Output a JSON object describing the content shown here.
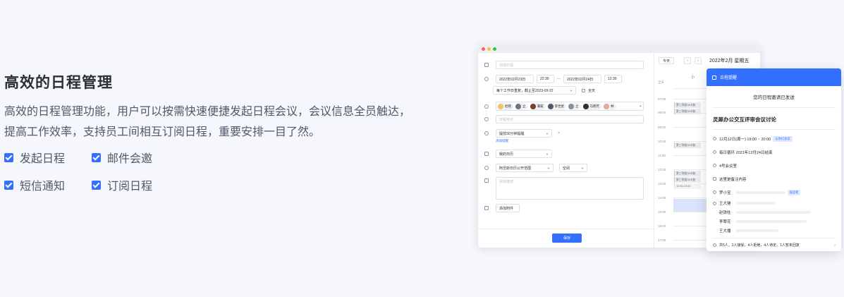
{
  "hero": {
    "title": "高效的日程管理",
    "desc_line1": "高效的日程管理功能，用户可以按需快速便捷发起日程会议，会议信息全员触达，",
    "desc_line2": "提高工作效率，支持员工间相互订阅日程，重要安排一目了然。",
    "features": [
      "发起日程",
      "邮件会邀",
      "短信通知",
      "订阅日程"
    ]
  },
  "colors": {
    "accent": "#3370ff",
    "window_dots": [
      "#ff5f57",
      "#febc2e",
      "#28c840"
    ]
  },
  "form": {
    "title_placeholder": "添加日程",
    "start_date": "2022年02月23日",
    "start_time": "22:30",
    "dash": "—",
    "end_date": "2022年02月24日",
    "end_time": "12:30",
    "repeat": "每个工作日重复，截止至2023-09-22",
    "all_day": "全天",
    "attendees": [
      "杜晓",
      "立",
      "蒲渠",
      "李世星",
      "立",
      "马明芳",
      "林"
    ],
    "location_placeholder": "日程地点",
    "reminder": "提前30分钟提醒",
    "add_reminder": "添加提醒",
    "calendar": "我的日历",
    "visibility": "阿旦斯日历公开范围",
    "status": "空闲",
    "desc_placeholder": "添加描述",
    "attach": "添加附件",
    "save": "保存"
  },
  "calendar": {
    "today": "今天",
    "prev": "‹",
    "next": "›",
    "date_label": "2022年2月 星期五",
    "col_label": "小",
    "allday_label": "全天",
    "hours": [
      "07:00",
      "08:00",
      "09:00",
      "10:00",
      "11:00",
      "12:00",
      "13:00",
      "14:00",
      "15:00",
      "16:00",
      "17:00"
    ],
    "events": [
      "第三季度OKR复",
      "第三季度OKR复",
      "第三季度OKR复",
      "第三季度OKR复",
      "第三季度OKR复",
      "12:00-15:00"
    ]
  },
  "popup": {
    "header": "日程提醒",
    "sent": "您的日程邀请已发送",
    "title": "灵犀办公交互评审会议讨论",
    "time": "12月12日(周一) 19:00 ~ 20:00",
    "time_tag": "与你们会议",
    "repeat": "每日循环 2021年12月24日结束",
    "room": "4号会议室",
    "note": "这里是备注内容",
    "organizer": "罗小宝",
    "organizer_tag": "发起者",
    "attendees": [
      "王大锤",
      "赵铁柱",
      "李翠花",
      "王大播"
    ],
    "summary": "共5人，2人接受，4人拒绝，4人待定，1人暂未回复",
    "more": "›"
  }
}
